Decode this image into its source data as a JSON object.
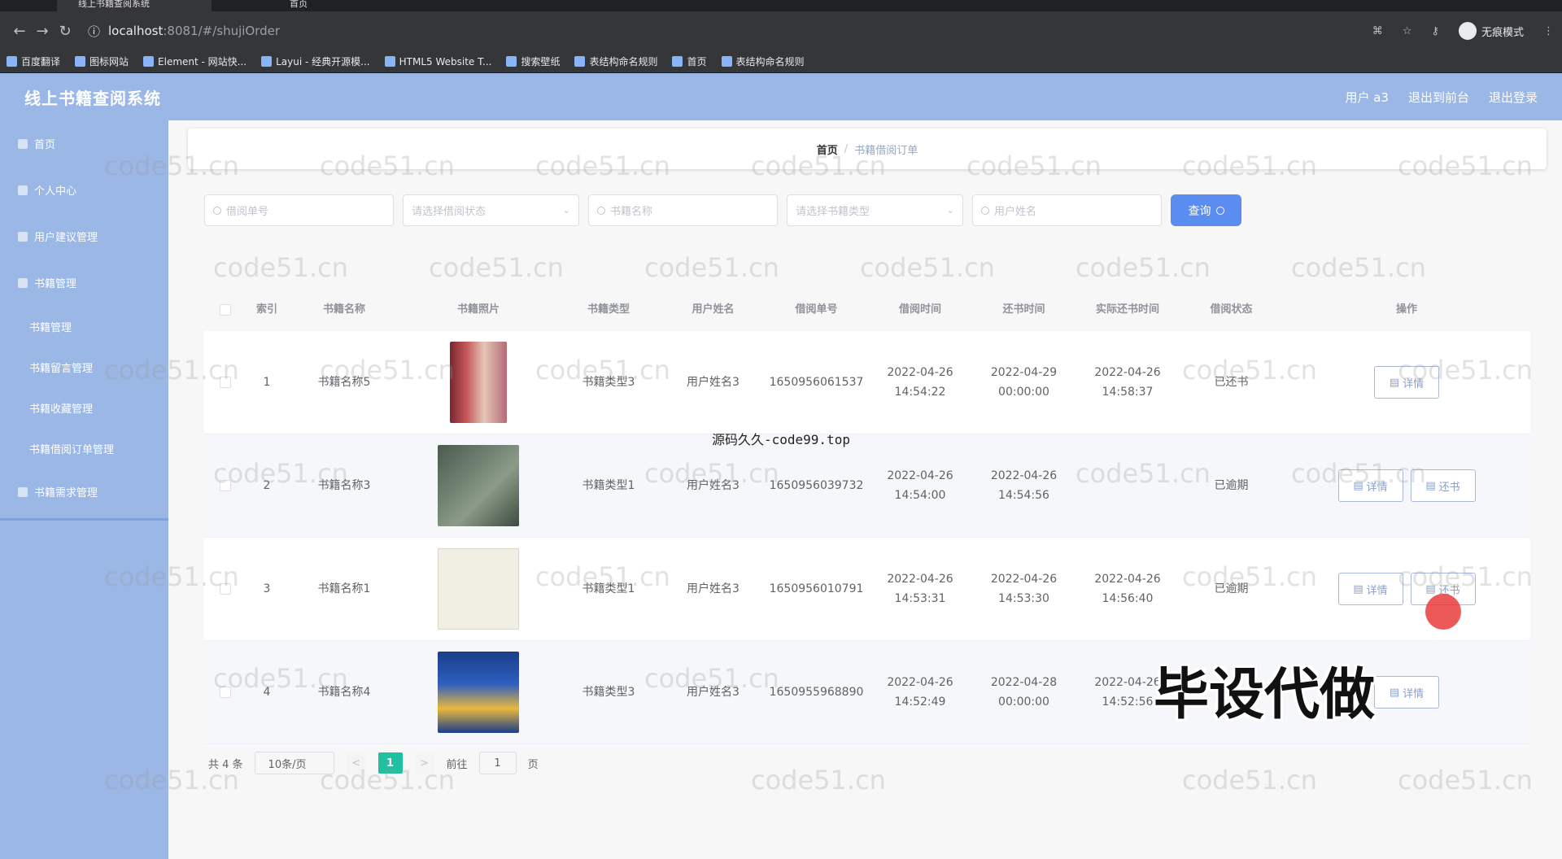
{
  "browser": {
    "tabs": [
      "线上书籍查阅系统",
      "首页"
    ],
    "url_host": "localhost",
    "url_path": ":8081/#/shujiOrder",
    "incognito_label": "无痕模式",
    "bookmarks": [
      "百度翻译",
      "图标网站",
      "Element - 网站快...",
      "Layui - 经典开源模...",
      "HTML5 Website T...",
      "搜索壁纸",
      "表结构命名规则",
      "首页",
      "表结构命名规则"
    ]
  },
  "header": {
    "title": "线上书籍查阅系统",
    "links": [
      "用户 a3",
      "退出到前台",
      "退出登录"
    ]
  },
  "sidebar": {
    "items": [
      {
        "label": "首页",
        "type": "item"
      },
      {
        "label": "个人中心",
        "type": "item"
      },
      {
        "label": "用户建议管理",
        "type": "item"
      },
      {
        "label": "书籍管理",
        "type": "item"
      },
      {
        "label": "书籍管理",
        "type": "sub"
      },
      {
        "label": "书籍留言管理",
        "type": "sub"
      },
      {
        "label": "书籍收藏管理",
        "type": "sub"
      },
      {
        "label": "书籍借阅订单管理",
        "type": "sub"
      },
      {
        "label": "书籍需求管理",
        "type": "item"
      }
    ]
  },
  "breadcrumb": {
    "home": "首页",
    "sep": "/",
    "current": "书籍借阅订单"
  },
  "search": {
    "borrow_no_placeholder": "借阅单号",
    "status_placeholder": "请选择借阅状态",
    "book_name_placeholder": "书籍名称",
    "book_type_placeholder": "请选择书籍类型",
    "user_name_placeholder": "用户姓名",
    "query_label": "查询"
  },
  "table": {
    "headers": [
      "索引",
      "书籍名称",
      "书籍照片",
      "书籍类型",
      "用户姓名",
      "借阅单号",
      "借阅时间",
      "还书时间",
      "实际还书时间",
      "借阅状态",
      "操作"
    ],
    "rows": [
      {
        "idx": "1",
        "name": "书籍名称5",
        "type": "书籍类型3",
        "user": "用户姓名3",
        "no": "1650956061537",
        "borrow": "2022-04-26 14:54:22",
        "return": "2022-04-29 00:00:00",
        "actual": "2022-04-26 14:58:37",
        "status": "已还书",
        "btn1": "详情",
        "btn2": ""
      },
      {
        "idx": "2",
        "name": "书籍名称3",
        "type": "书籍类型1",
        "user": "用户姓名3",
        "no": "1650956039732",
        "borrow": "2022-04-26 14:54:00",
        "return": "2022-04-26 14:54:56",
        "actual": "",
        "status": "已逾期",
        "btn1": "详情",
        "btn2": "还书"
      },
      {
        "idx": "3",
        "name": "书籍名称1",
        "type": "书籍类型1",
        "user": "用户姓名3",
        "no": "1650956010791",
        "borrow": "2022-04-26 14:53:31",
        "return": "2022-04-26 14:53:30",
        "actual": "2022-04-26 14:56:40",
        "status": "已逾期",
        "btn1": "详情",
        "btn2": "还书"
      },
      {
        "idx": "4",
        "name": "书籍名称4",
        "type": "书籍类型3",
        "user": "用户姓名3",
        "no": "1650955968890",
        "borrow": "2022-04-26 14:52:49",
        "return": "2022-04-28 00:00:00",
        "actual": "2022-04-26 14:52:56",
        "status": "",
        "btn1": "详情",
        "btn2": ""
      }
    ]
  },
  "pagination": {
    "total": "共 4 条",
    "page_size": "10条/页",
    "prev": "<",
    "current": "1",
    "next": ">",
    "goto_label": "前往",
    "goto_value": "1",
    "page_unit": "页"
  },
  "overlays": {
    "watermark": "code51.cn",
    "caption": "源码久久-code99.top",
    "banner": "毕设代做"
  },
  "colors": {
    "header_bg": "#9bb7e6",
    "query_btn": "#5b8df1",
    "page_active": "#21c0a0"
  }
}
